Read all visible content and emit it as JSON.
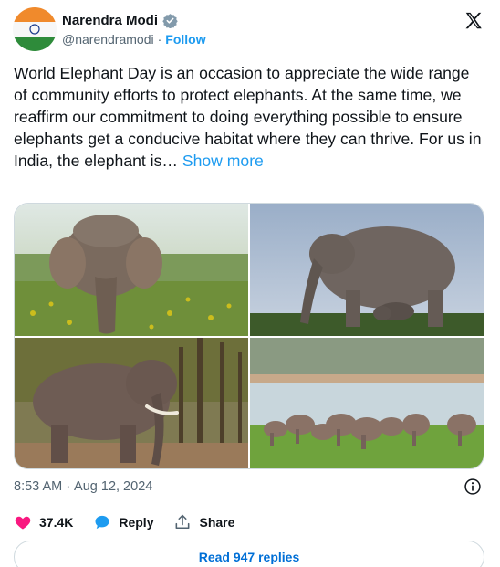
{
  "author": {
    "display_name": "Narendra Modi",
    "handle": "@narendramodi",
    "separator": "·",
    "follow_label": "Follow",
    "verified_color": "#829aab"
  },
  "tweet": {
    "text": "World Elephant Day is an occasion to appreciate the wide range of community efforts to protect elephants. At the same time, we reaffirm our commitment to doing everything possible to ensure elephants get a conducive habitat where they can thrive. For us in India, the elephant is…",
    "show_more_label": "Show more",
    "time": "8:53 AM",
    "date_separator": "·",
    "date": "Aug 12, 2024"
  },
  "engagement": {
    "likes": "37.4K",
    "reply_label": "Reply",
    "share_label": "Share",
    "read_replies_label": "Read 947 replies"
  },
  "colors": {
    "accent": "#1d9bf0",
    "like": "#f91880",
    "muted": "#536471",
    "border": "#cfd9de"
  }
}
